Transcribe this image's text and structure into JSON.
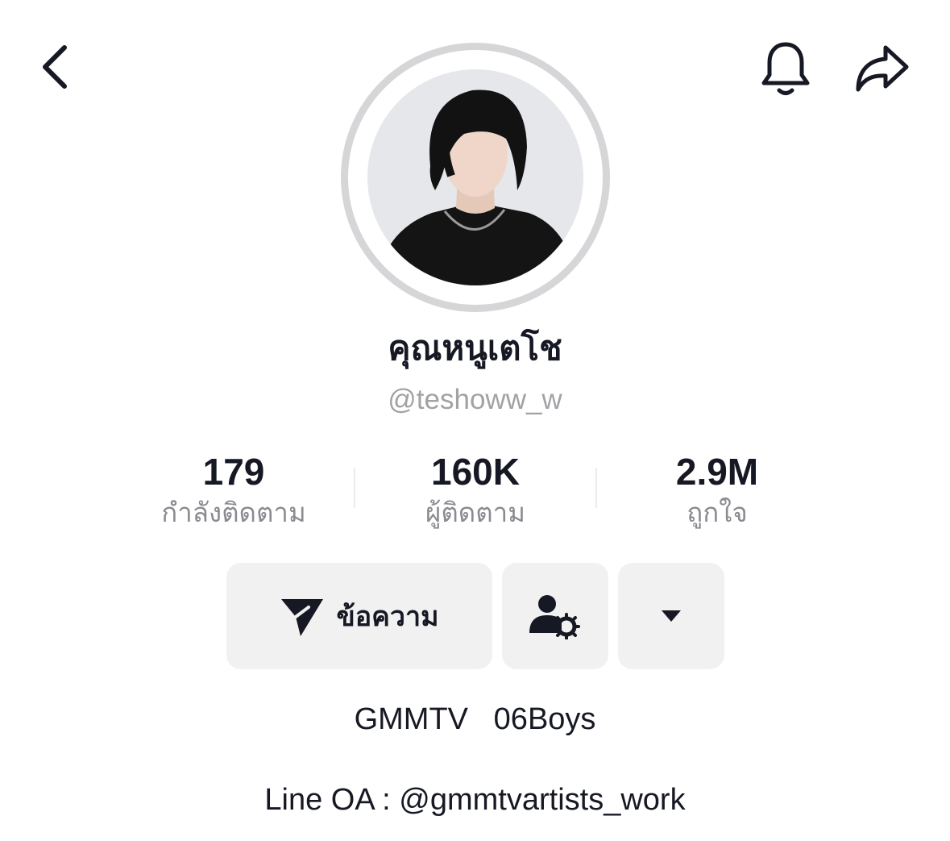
{
  "header": {
    "back_icon": "chevron-left-icon",
    "bell_icon": "bell-icon",
    "share_icon": "share-arrow-icon"
  },
  "profile": {
    "display_name": "คุณหนูเตโช",
    "username": "@teshoww_w"
  },
  "stats": [
    {
      "value": "179",
      "label": "กำลังติดตาม"
    },
    {
      "value": "160K",
      "label": "ผู้ติดตาม"
    },
    {
      "value": "2.9M",
      "label": "ถูกใจ"
    }
  ],
  "actions": {
    "message_label": "ข้อความ",
    "message_icon": "send-icon",
    "friends_icon": "user-settings-icon",
    "more_icon": "caret-down-icon"
  },
  "bio": {
    "line1": "GMMTV   06Boys",
    "line2": "Line OA : @gmmtvartists_work"
  },
  "colors": {
    "text_primary": "#161823",
    "text_secondary": "#8a8b91",
    "button_bg": "#f1f1f2",
    "avatar_ring": "#d6d6d8"
  }
}
